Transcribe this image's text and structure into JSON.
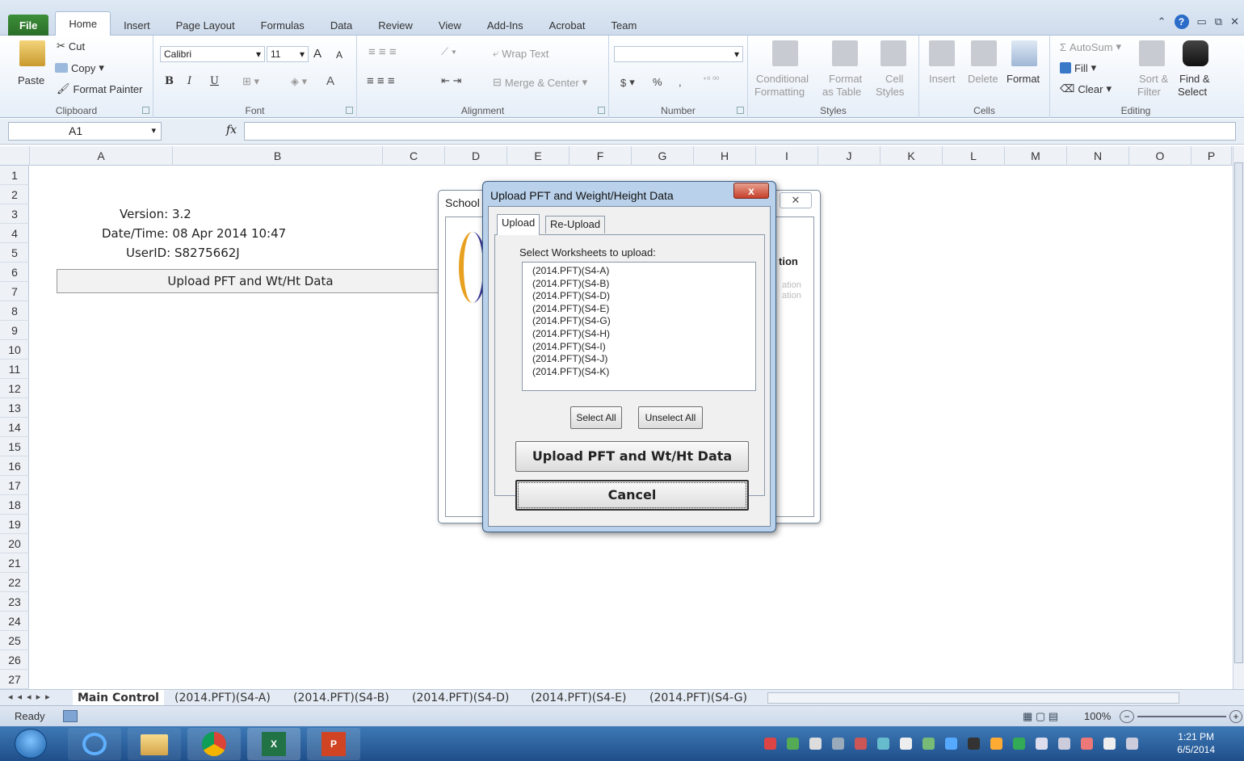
{
  "ribbon": {
    "tabs": [
      "File",
      "Home",
      "Insert",
      "Page Layout",
      "Formulas",
      "Data",
      "Review",
      "View",
      "Add-Ins",
      "Acrobat",
      "Team"
    ],
    "active_tab": "Home",
    "clipboard": {
      "paste": "Paste",
      "cut": "Cut",
      "copy": "Copy",
      "format_painter": "Format Painter",
      "label": "Clipboard"
    },
    "font": {
      "name": "Calibri",
      "size": "11",
      "bold": "B",
      "italic": "I",
      "underline": "U",
      "grow": "A",
      "shrink": "A",
      "color": "A",
      "label": "Font"
    },
    "alignment": {
      "wrap_text": "Wrap Text",
      "merge_center": "Merge & Center",
      "label": "Alignment"
    },
    "number": {
      "currency": "$",
      "percent": "%",
      "comma": ",",
      "label": "Number"
    },
    "styles": {
      "conditional": "Conditional",
      "conditional2": "Formatting",
      "format_table": "Format",
      "format_table2": "as Table",
      "cell_styles": "Cell",
      "cell_styles2": "Styles",
      "label": "Styles"
    },
    "cells": {
      "insert": "Insert",
      "delete": "Delete",
      "format": "Format",
      "label": "Cells"
    },
    "editing": {
      "autosum": "AutoSum",
      "fill": "Fill",
      "clear": "Clear",
      "sort": "Sort &",
      "sort2": "Filter",
      "find": "Find &",
      "find2": "Select",
      "label": "Editing"
    }
  },
  "formula_bar": {
    "name_box": "A1",
    "fx": "fx",
    "value": ""
  },
  "columns": [
    "A",
    "B",
    "C",
    "D",
    "E",
    "F",
    "G",
    "H",
    "I",
    "J",
    "K",
    "L",
    "M",
    "N",
    "O",
    "P"
  ],
  "rows": [
    "1",
    "2",
    "3",
    "4",
    "5",
    "6",
    "7",
    "8",
    "9",
    "10",
    "11",
    "12",
    "13",
    "14",
    "15",
    "16",
    "17",
    "18",
    "19",
    "20",
    "21",
    "22",
    "23",
    "24",
    "25",
    "26",
    "27"
  ],
  "sheet_content": {
    "version": "Version: 3.2",
    "datetime": "Date/Time: 08 Apr 2014 10:47",
    "userid": "UserID: S8275662J",
    "upload_button": "Upload PFT and Wt/Ht Data"
  },
  "sheet_tabs": [
    "Main Control",
    "(2014.PFT)(S4-A)",
    "(2014.PFT)(S4-B)",
    "(2014.PFT)(S4-D)",
    "(2014.PFT)(S4-E)",
    "(2014.PFT)(S4-G)"
  ],
  "active_sheet": "Main Control",
  "status": {
    "ready": "Ready",
    "zoom": "100%"
  },
  "taskbar": {
    "time": "1:21 PM",
    "date": "6/5/2014"
  },
  "dialog_behind": {
    "title": "School",
    "close": "✕",
    "partial_heading": "tion",
    "partial_line1": "ation",
    "partial_line2": "ation"
  },
  "dialog": {
    "title": "Upload PFT and Weight/Height Data",
    "close": "x",
    "tabs": [
      "Upload",
      "Re-Upload"
    ],
    "active_tab": "Upload",
    "list_label": "Select Worksheets to upload:",
    "worksheets": [
      "(2014.PFT)(S4-A)",
      "(2014.PFT)(S4-B)",
      "(2014.PFT)(S4-D)",
      "(2014.PFT)(S4-E)",
      "(2014.PFT)(S4-G)",
      "(2014.PFT)(S4-H)",
      "(2014.PFT)(S4-I)",
      "(2014.PFT)(S4-J)",
      "(2014.PFT)(S4-K)"
    ],
    "select_all": "Select All",
    "unselect_all": "Unselect All",
    "upload_button": "Upload PFT and Wt/Ht Data",
    "cancel_button": "Cancel"
  },
  "colors": {
    "file_tab": "#2a6e27",
    "dialog_frame": "#b9d1ea",
    "close_red": "#c6402a",
    "taskbar": "#1f4f8a"
  }
}
